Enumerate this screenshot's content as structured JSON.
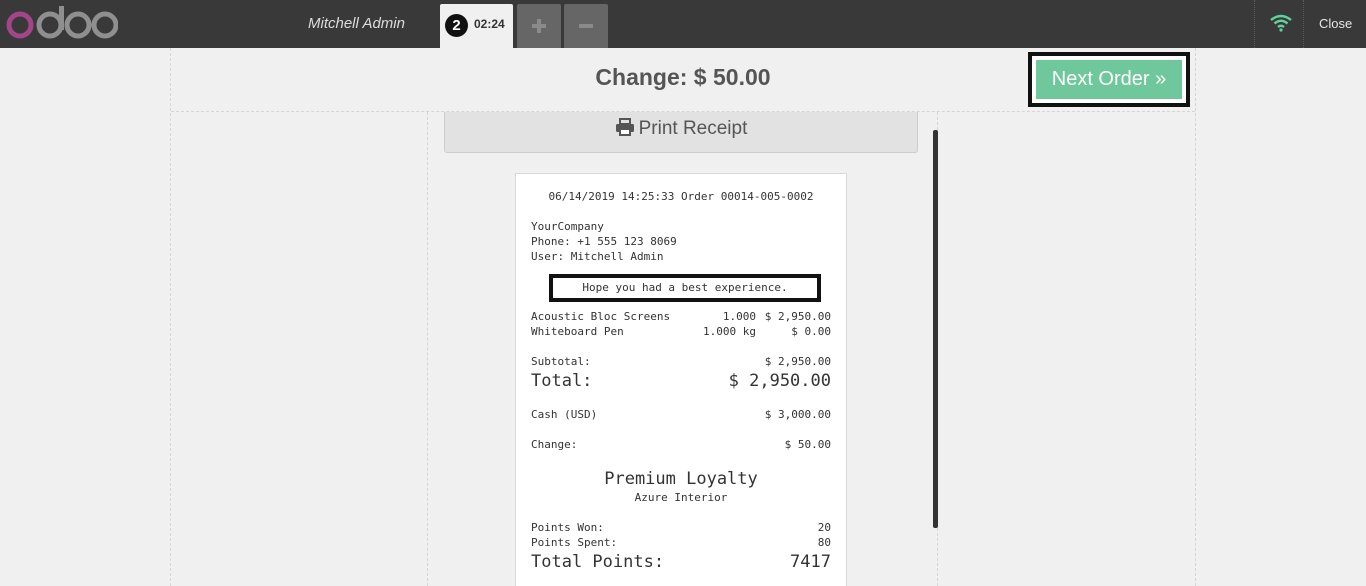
{
  "topbar": {
    "logo": "odoo",
    "cashier": "Mitchell Admin",
    "order_number": "2",
    "order_time": "02:24",
    "close_label": "Close"
  },
  "screen": {
    "change_title": "Change: $ 50.00",
    "next_order_label": "Next Order »",
    "print_receipt_label": "Print Receipt"
  },
  "receipt": {
    "header": "06/14/2019 14:25:33 Order 00014-005-0002",
    "company": "YourCompany",
    "phone": "Phone: +1 555 123 8069",
    "user": "User: Mitchell Admin",
    "message": "Hope you had a best experience.",
    "lines": [
      {
        "product": "Acoustic Bloc Screens",
        "qty": "1.000",
        "price": "$ 2,950.00"
      },
      {
        "product": "Whiteboard Pen",
        "qty": "1.000 kg",
        "price": "$ 0.00"
      }
    ],
    "subtotal_label": "Subtotal:",
    "subtotal_value": "$ 2,950.00",
    "total_label": "Total:",
    "total_value": "$ 2,950.00",
    "payment_label": "Cash (USD)",
    "payment_value": "$ 3,000.00",
    "change_label": "Change:",
    "change_value": "$ 50.00",
    "loyalty_title": "Premium Loyalty",
    "loyalty_customer": "Azure Interior",
    "points_won_label": "Points Won:",
    "points_won_value": "20",
    "points_spent_label": "Points Spent:",
    "points_spent_value": "80",
    "total_points_label": "Total Points:",
    "total_points_value": "7417"
  },
  "colors": {
    "topbar": "#393939",
    "accent_green": "#6ec89b",
    "logo_pink": "#a24689"
  }
}
